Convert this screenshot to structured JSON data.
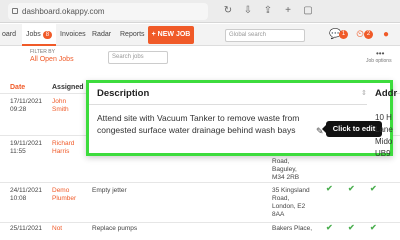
{
  "browser": {
    "url": "dashboard.okappy.com"
  },
  "nav": {
    "items": [
      "oard",
      "Jobs",
      "Invoices",
      "Radar",
      "Reports"
    ],
    "jobs_badge": "8",
    "new_job": "+ NEW JOB",
    "search_placeholder": "Global search",
    "badge_a": "1",
    "badge_b": "2"
  },
  "filter": {
    "label": "FILTER BY",
    "value": "All Open Jobs",
    "search_placeholder": "Search jobs",
    "options_label": "Job options"
  },
  "table": {
    "headers": [
      "Date",
      "Assigned"
    ],
    "rows": [
      {
        "date": "17/11/2021",
        "time": "09:28",
        "assigned": [
          "John",
          "Smith"
        ],
        "description": "",
        "address": []
      },
      {
        "date": "19/11/2021",
        "time": "11:55",
        "assigned": [
          "Richard",
          "Harris"
        ],
        "description": "",
        "address": [
          "Road,",
          "Baguley,",
          "M34 2RB"
        ]
      },
      {
        "date": "24/11/2021",
        "time": "10:08",
        "assigned": [
          "Demo",
          "Plumber"
        ],
        "description": "Empty jetter",
        "address": [
          "35 Kingsland",
          "Road,",
          "London, E2",
          "8AA"
        ]
      },
      {
        "date": "25/11/2021",
        "time": "",
        "assigned": [
          "Not"
        ],
        "description": "Replace pumps",
        "address": [
          "Bakers Place,"
        ]
      }
    ]
  },
  "popover": {
    "header": "Description",
    "address_header": "Addr",
    "text": "Attend site with Vacuum Tanker to remove waste from congested surface water drainage behind wash bays",
    "address_lines": [
      "10 H",
      "Lane",
      "Mido",
      "UB9"
    ],
    "tooltip": "Click to edit"
  },
  "colors": {
    "accent": "#f05a28",
    "highlight": "#3ddc3d",
    "check": "#4caf50"
  }
}
